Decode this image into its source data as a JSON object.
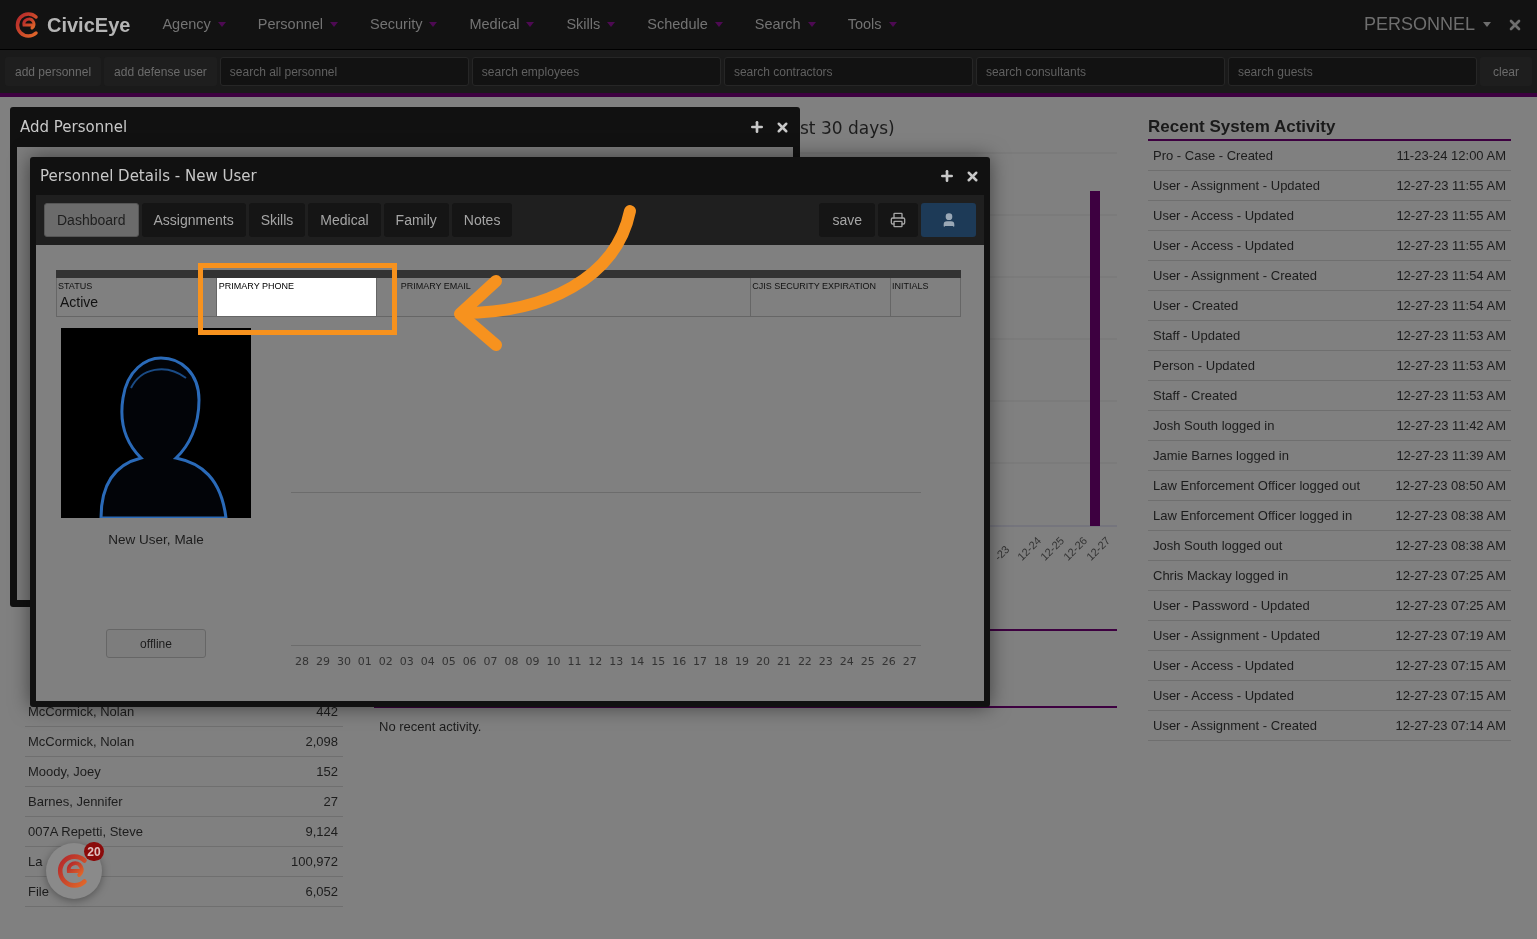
{
  "nav": {
    "brand": "CivicEye",
    "menus": [
      "Agency",
      "Personnel",
      "Security",
      "Medical",
      "Skills",
      "Schedule",
      "Search",
      "Tools"
    ],
    "context": "PERSONNEL"
  },
  "toolbar": {
    "buttons": [
      "add personnel",
      "add defense user"
    ],
    "searches": [
      {
        "placeholder": "search all personnel"
      },
      {
        "placeholder": "search employees"
      },
      {
        "placeholder": "search contractors"
      },
      {
        "placeholder": "search consultants"
      },
      {
        "placeholder": "search guests"
      }
    ],
    "clear": "clear"
  },
  "left_list": [
    {
      "name": "McCormick, Nolan",
      "value": "442"
    },
    {
      "name": "McCormick, Nolan",
      "value": "2,098"
    },
    {
      "name": "Moody, Joey",
      "value": "152"
    },
    {
      "name": "Barnes, Jennifer",
      "value": "27"
    },
    {
      "name": "007A Repetti, Steve",
      "value": "9,124"
    },
    {
      "name": "La",
      "value": "100,972"
    },
    {
      "name": "File",
      "value": "6,052"
    }
  ],
  "activity_chart": {
    "title": "st 30 days)",
    "x_labels": [
      "-23",
      "12-24",
      "12-25",
      "12-26",
      "12-27"
    ]
  },
  "recent_section": {
    "empty_text": "No recent activity."
  },
  "recent_activity": {
    "title": "Recent System Activity",
    "rows": [
      {
        "event": "Pro - Case - Created",
        "time": "11-23-24 12:00 AM"
      },
      {
        "event": "User - Assignment - Updated",
        "time": "12-27-23 11:55 AM"
      },
      {
        "event": "User - Access - Updated",
        "time": "12-27-23 11:55 AM"
      },
      {
        "event": "User - Access - Updated",
        "time": "12-27-23 11:55 AM"
      },
      {
        "event": "User - Assignment - Created",
        "time": "12-27-23 11:54 AM"
      },
      {
        "event": "User - Created",
        "time": "12-27-23 11:54 AM"
      },
      {
        "event": "Staff - Updated",
        "time": "12-27-23 11:53 AM"
      },
      {
        "event": "Person - Updated",
        "time": "12-27-23 11:53 AM"
      },
      {
        "event": "Staff - Created",
        "time": "12-27-23 11:53 AM"
      },
      {
        "event": "Josh South logged in",
        "time": "12-27-23 11:42 AM"
      },
      {
        "event": "Jamie Barnes logged in",
        "time": "12-27-23 11:39 AM"
      },
      {
        "event": "Law Enforcement Officer logged out",
        "time": "12-27-23 08:50 AM"
      },
      {
        "event": "Law Enforcement Officer logged in",
        "time": "12-27-23 08:38 AM"
      },
      {
        "event": "Josh South logged out",
        "time": "12-27-23 08:38 AM"
      },
      {
        "event": "Chris Mackay logged in",
        "time": "12-27-23 07:25 AM"
      },
      {
        "event": "User - Password - Updated",
        "time": "12-27-23 07:25 AM"
      },
      {
        "event": "User - Assignment - Updated",
        "time": "12-27-23 07:19 AM"
      },
      {
        "event": "User - Access - Updated",
        "time": "12-27-23 07:15 AM"
      },
      {
        "event": "User - Access - Updated",
        "time": "12-27-23 07:15 AM"
      },
      {
        "event": "User - Assignment - Created",
        "time": "12-27-23 07:14 AM"
      }
    ]
  },
  "add_window": {
    "title": "Add Personnel"
  },
  "details_window": {
    "title": "Personnel Details - New User",
    "tabs": [
      {
        "label": "Dashboard",
        "selected": true
      },
      {
        "label": "Assignments",
        "selected": false
      },
      {
        "label": "Skills",
        "selected": false
      },
      {
        "label": "Medical",
        "selected": false
      },
      {
        "label": "Family",
        "selected": false
      },
      {
        "label": "Notes",
        "selected": false
      }
    ],
    "save": "save",
    "fields": [
      {
        "label": "STATUS",
        "value": "Active",
        "kind": "text"
      },
      {
        "label": "PRIMARY PHONE",
        "kind": "input"
      },
      {
        "label": "PRIMARY EMAIL",
        "kind": "text"
      },
      {
        "label": "CJIS SECURITY EXPIRATION",
        "kind": "text"
      },
      {
        "label": "INITIALS",
        "kind": "text"
      }
    ],
    "person": {
      "caption": "New User, Male",
      "status": "offline"
    },
    "chart_labels": [
      "28",
      "29",
      "30",
      "01",
      "02",
      "03",
      "04",
      "05",
      "06",
      "07",
      "08",
      "09",
      "10",
      "11",
      "12",
      "13",
      "14",
      "15",
      "16",
      "17",
      "18",
      "19",
      "20",
      "21",
      "22",
      "23",
      "24",
      "25",
      "26",
      "27"
    ]
  },
  "chat_badge": {
    "count": "20"
  }
}
